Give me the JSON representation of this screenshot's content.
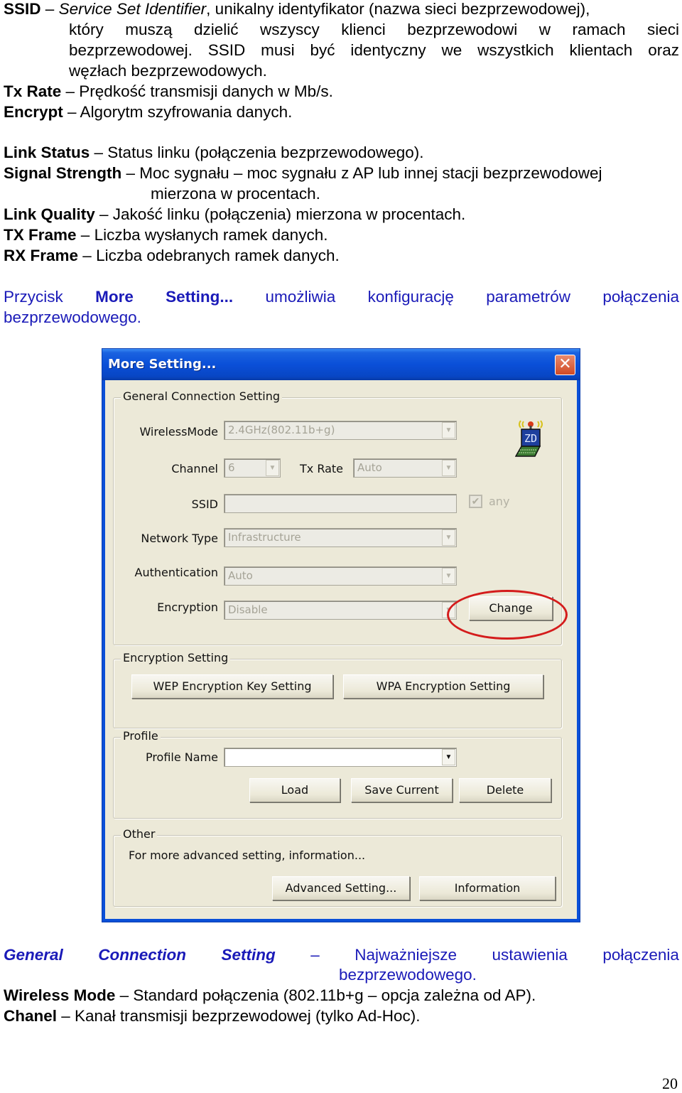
{
  "top_text": {
    "ssid": {
      "term": "SSID",
      "dash": "–",
      "italic": "Service Set Identifier",
      "line1_rest": ", unikalny identyfikator (nazwa sieci bezprzewodowej),",
      "line2_words": [
        "który",
        "muszą",
        "dzielić",
        "wszyscy",
        "klienci",
        "bezprzewodowi",
        "w",
        "ramach",
        "sieci"
      ],
      "line3_words": [
        "bezprzewodowej.",
        "SSID",
        "musi",
        "być",
        "identyczny",
        "we",
        "wszystkich",
        "klientach",
        "oraz"
      ],
      "line4": "węzłach bezprzewodowych."
    },
    "tx_rate": {
      "term": "Tx Rate",
      "desc": " – Prędkość transmisji danych w Mb/s."
    },
    "encrypt": {
      "term": "Encrypt",
      "desc": " – Algorytm szyfrowania danych."
    },
    "link_status": {
      "term": "Link Status",
      "desc": " – Status linku (połączenia bezprzewodowego)."
    },
    "signal_strength": {
      "term": "Signal Strength",
      "desc": " – Moc sygnału – moc sygnału z AP lub innej stacji bezprzewodowej",
      "line2": "mierzona w procentach."
    },
    "link_quality": {
      "term": "Link Quality",
      "desc": " – Jakość linku (połączenia) mierzona w procentach."
    },
    "tx_frame": {
      "term": "TX Frame",
      "desc": " – Liczba wysłanych ramek danych."
    },
    "rx_frame": {
      "term": "RX Frame",
      "desc": " – Liczba odebranych ramek danych."
    },
    "more_setting_para": {
      "words": [
        "Przycisk",
        "More",
        "Setting...",
        "umożliwia",
        "konfigurację",
        "parametrów",
        "połączenia"
      ],
      "line2": "bezprzewodowego."
    }
  },
  "dialog": {
    "title": "More Setting...",
    "close_glyph": "✕",
    "general": {
      "legend": "General Connection Setting",
      "wireless_mode_label": "WirelessMode",
      "wireless_mode_value": "2.4GHz(802.11b+g)",
      "channel_label": "Channel",
      "channel_value": "6",
      "tx_rate_label": "Tx Rate",
      "tx_rate_value": "Auto",
      "ssid_label": "SSID",
      "ssid_value": "",
      "any_label": "any",
      "any_checked": true,
      "network_type_label": "Network Type",
      "network_type_value": "Infrastructure",
      "authentication_label": "Authentication",
      "authentication_value": "Auto",
      "encryption_label": "Encryption",
      "encryption_value": "Disable",
      "change_button": "Change",
      "logo_text": "ZD"
    },
    "encryption_setting": {
      "legend": "Encryption Setting",
      "wep_button": "WEP Encryption Key Setting",
      "wpa_button": "WPA Encryption Setting"
    },
    "profile": {
      "legend": "Profile",
      "name_label": "Profile Name",
      "name_value": "",
      "load_button": "Load",
      "save_button": "Save Current",
      "delete_button": "Delete"
    },
    "other": {
      "legend": "Other",
      "description": "For more advanced setting, information...",
      "advanced_button": "Advanced Setting...",
      "information_button": "Information"
    },
    "arrow_glyph": "▼",
    "check_glyph": "✔"
  },
  "bottom_text": {
    "gcs": {
      "words": [
        "General",
        "Connection",
        "Setting",
        "–",
        "Najważniejsze",
        "ustawienia",
        "połączenia"
      ],
      "line2": "bezprzewodowego."
    },
    "wireless_mode": {
      "term": "Wireless Mode",
      "desc": " – Standard połączenia (802.11b+g – opcja zależna od AP)."
    },
    "chanel": {
      "term": "Chanel",
      "desc": " – Kanał transmisji bezprzewodowej (tylko Ad-Hoc)."
    }
  },
  "page_number": "20",
  "colors": {
    "accent_blue": "#1a1ab8",
    "highlight_red": "#d41c1c",
    "titlebar_blue": "#0a4fd8"
  }
}
